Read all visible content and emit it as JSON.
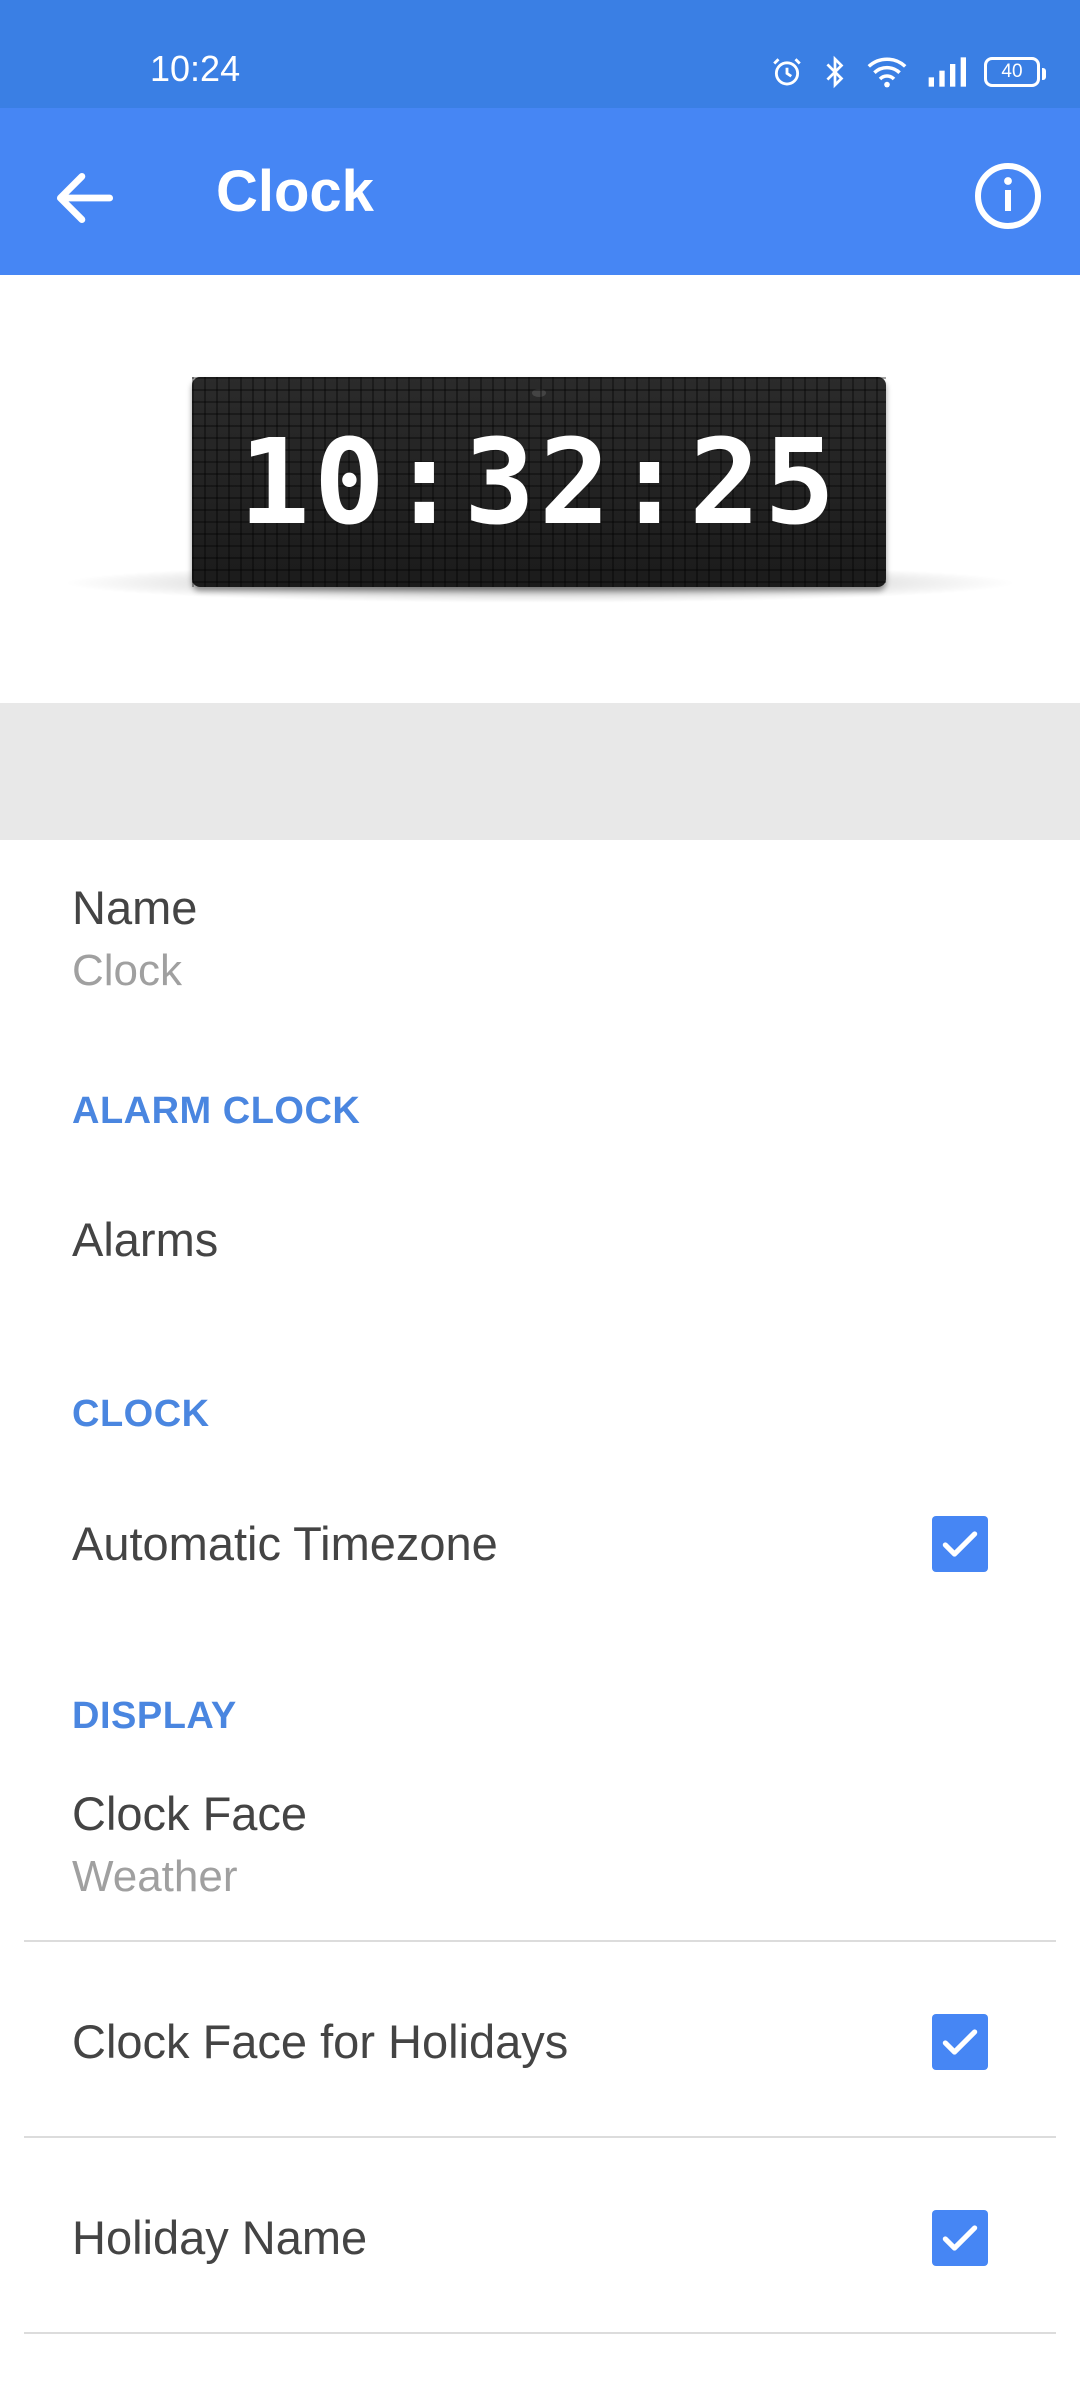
{
  "status_bar": {
    "time": "10:24",
    "battery": "40",
    "icons": [
      "alarm-icon",
      "bluetooth-icon",
      "wifi-icon",
      "signal-icon",
      "battery-icon"
    ]
  },
  "app_bar": {
    "title": "Clock",
    "back_icon": "arrow-left-icon",
    "info_icon": "info-icon",
    "color": "#4686f4"
  },
  "device_preview": {
    "display_text": "10:32:25"
  },
  "settings": {
    "name": {
      "label": "Name",
      "value": "Clock"
    },
    "alarm_section": {
      "header": "ALARM CLOCK",
      "alarms_label": "Alarms"
    },
    "clock_section": {
      "header": "CLOCK",
      "auto_timezone": {
        "label": "Automatic Timezone",
        "checked": true
      }
    },
    "display_section": {
      "header": "DISPLAY",
      "clock_face": {
        "label": "Clock Face",
        "value": "Weather"
      },
      "holiday_face": {
        "label": "Clock Face for Holidays",
        "checked": true
      },
      "holiday_name": {
        "label": "Holiday Name",
        "checked": true
      }
    }
  },
  "colors": {
    "accent": "#4a86e0",
    "status_bar": "#3a7fe4",
    "checkbox": "#4686f4"
  }
}
